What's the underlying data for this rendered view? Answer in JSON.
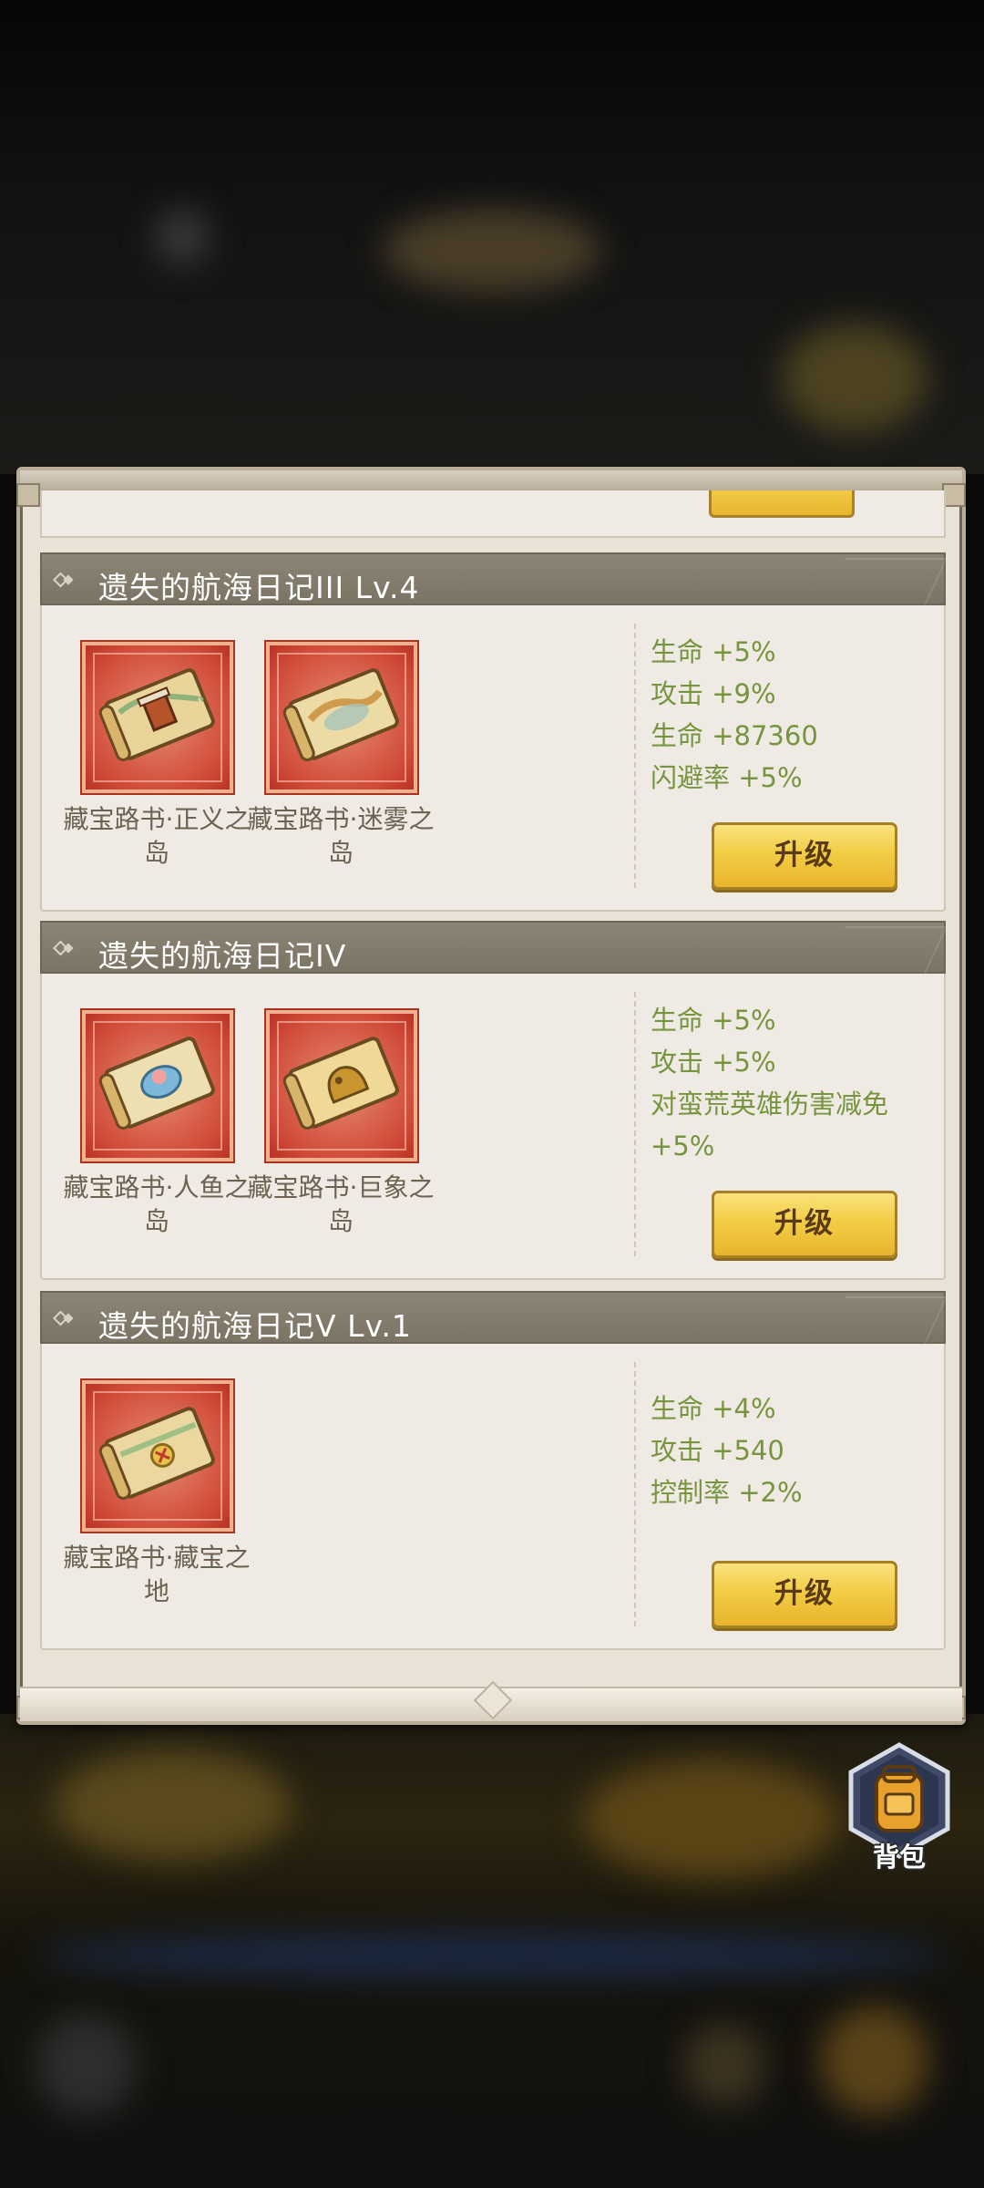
{
  "sets": [
    {
      "title": "遗失的航海日记III Lv.4",
      "items": [
        {
          "name": "藏宝路书·正义之岛",
          "icon": "treasure-map-justice-island-icon"
        },
        {
          "name": "藏宝路书·迷雾之岛",
          "icon": "treasure-map-mist-island-icon"
        }
      ],
      "stats": [
        "生命 +5%",
        "攻击 +9%",
        "生命 +87360",
        "闪避率 +5%"
      ],
      "button": "升级"
    },
    {
      "title": "遗失的航海日记IV",
      "items": [
        {
          "name": "藏宝路书·人鱼之岛",
          "icon": "treasure-map-mermaid-island-icon"
        },
        {
          "name": "藏宝路书·巨象之岛",
          "icon": "treasure-map-elephant-island-icon"
        }
      ],
      "stats": [
        "生命 +5%",
        "攻击 +5%",
        "对蛮荒英雄伤害减免",
        "+5%"
      ],
      "button": "升级"
    },
    {
      "title": "遗失的航海日记V Lv.1",
      "items": [
        {
          "name": "藏宝路书·藏宝之地",
          "icon": "treasure-map-treasure-land-icon"
        }
      ],
      "stats": [
        "生命 +4%",
        "攻击 +540",
        "控制率 +2%"
      ],
      "button": "升级"
    }
  ],
  "bag": {
    "label": "背包",
    "icon": "backpack-icon"
  },
  "colors": {
    "panel": "#e9e2d7",
    "header": "#857d6d",
    "stat_text": "#77943f",
    "button": "#f2cd45",
    "item_frame": "#cf4a38"
  }
}
